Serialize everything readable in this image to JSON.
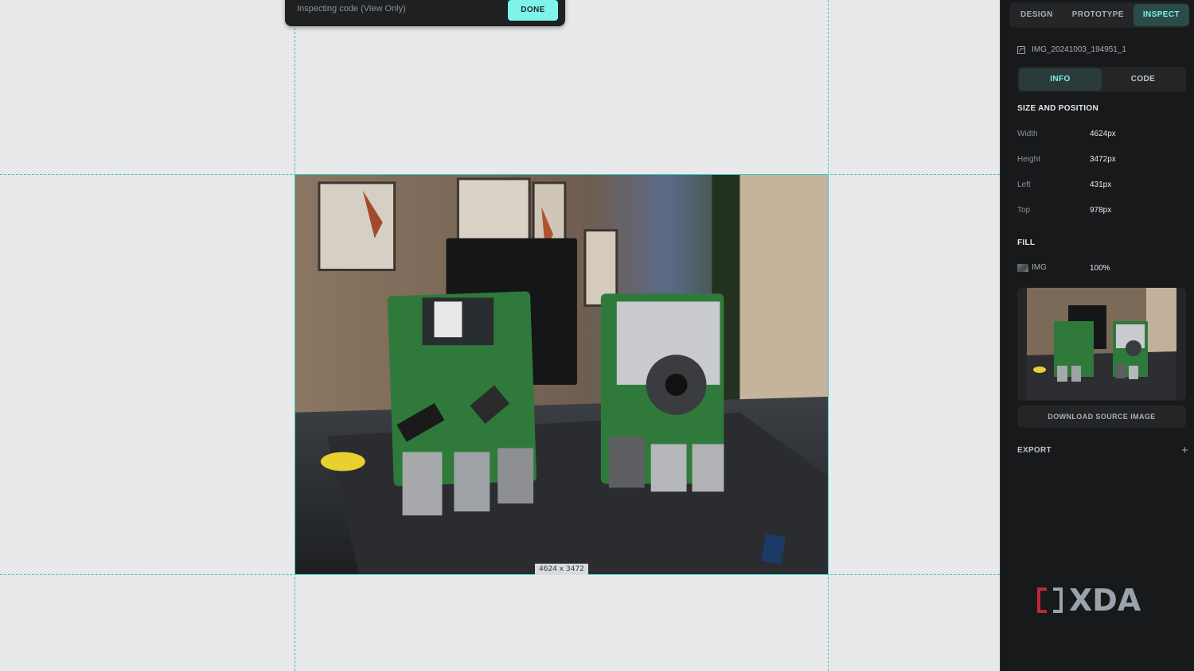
{
  "window": {
    "toast_message": "Inspecting code (View Only)",
    "done_label": "DONE"
  },
  "canvas": {
    "image_dimensions_label": "4624 x 3472"
  },
  "panel": {
    "mode_tabs": [
      "DESIGN",
      "PROTOTYPE",
      "INSPECT"
    ],
    "active_mode": "INSPECT",
    "layer_name": "IMG_20241003_194951_1",
    "sub_tabs": [
      "INFO",
      "CODE"
    ],
    "active_sub_tab": "INFO",
    "size_section": {
      "title": "SIZE AND POSITION",
      "width_label": "Width",
      "width_value": "4624px",
      "height_label": "Height",
      "height_value": "3472px",
      "left_label": "Left",
      "left_value": "431px",
      "top_label": "Top",
      "top_value": "978px"
    },
    "fill_section": {
      "title": "FILL",
      "type": "IMG",
      "opacity": "100%"
    },
    "download_label": "DOWNLOAD SOURCE IMAGE",
    "export_label": "EXPORT",
    "export_add_icon": "+"
  },
  "watermark": {
    "brand": "XDA"
  },
  "colors": {
    "accent": "#7ef3e9",
    "guide": "#35c9c1",
    "panel_bg": "#18191b",
    "canvas_bg": "#e8e9ea"
  },
  "icons": {
    "file": "image-file-icon",
    "fill": "image-fill-icon",
    "add": "plus-icon"
  }
}
